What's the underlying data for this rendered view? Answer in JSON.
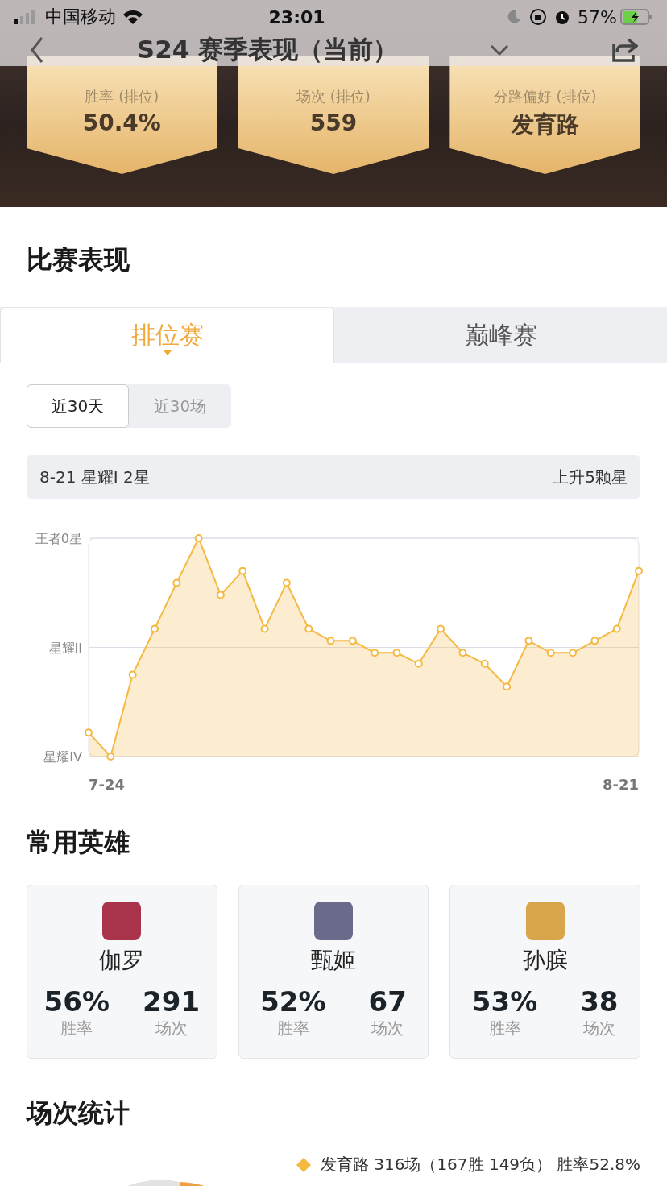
{
  "status_bar": {
    "carrier": "中国移动",
    "time": "23:01",
    "battery": "57%"
  },
  "nav": {
    "title": "S24 赛季表现（当前）"
  },
  "badges": [
    {
      "label": "胜率 (排位)",
      "value": "50.4%"
    },
    {
      "label": "场次 (排位)",
      "value": "559"
    },
    {
      "label": "分路偏好 (排位)",
      "value": "发育路"
    }
  ],
  "performance": {
    "title": "比赛表现",
    "tabs": [
      {
        "label": "排位赛",
        "selected": true
      },
      {
        "label": "巅峰赛",
        "selected": false
      }
    ],
    "ranges": [
      {
        "label": "近30天",
        "selected": true
      },
      {
        "label": "近30场",
        "selected": false
      }
    ],
    "summary": {
      "current": "8-21 星耀I 2星",
      "change": "上升5颗星"
    },
    "rank_chart": {
      "y_labels": [
        "王者0星",
        "星耀II",
        "星耀IV"
      ],
      "x_labels": [
        "7-24",
        "8-21"
      ]
    }
  },
  "heroes": {
    "title": "常用英雄",
    "items": [
      {
        "name": "伽罗",
        "win_rate": "56%",
        "win_label": "胜率",
        "games": "291",
        "games_label": "场次"
      },
      {
        "name": "甄姬",
        "win_rate": "52%",
        "win_label": "胜率",
        "games": "67",
        "games_label": "场次"
      },
      {
        "name": "孙膑",
        "win_rate": "53%",
        "win_label": "胜率",
        "games": "38",
        "games_label": "场次"
      }
    ]
  },
  "match_stats": {
    "title": "场次统计",
    "legend": [
      {
        "text": "发育路 316场（167胜 149负） 胜率52.8%",
        "color": "#f5b942"
      }
    ]
  }
}
